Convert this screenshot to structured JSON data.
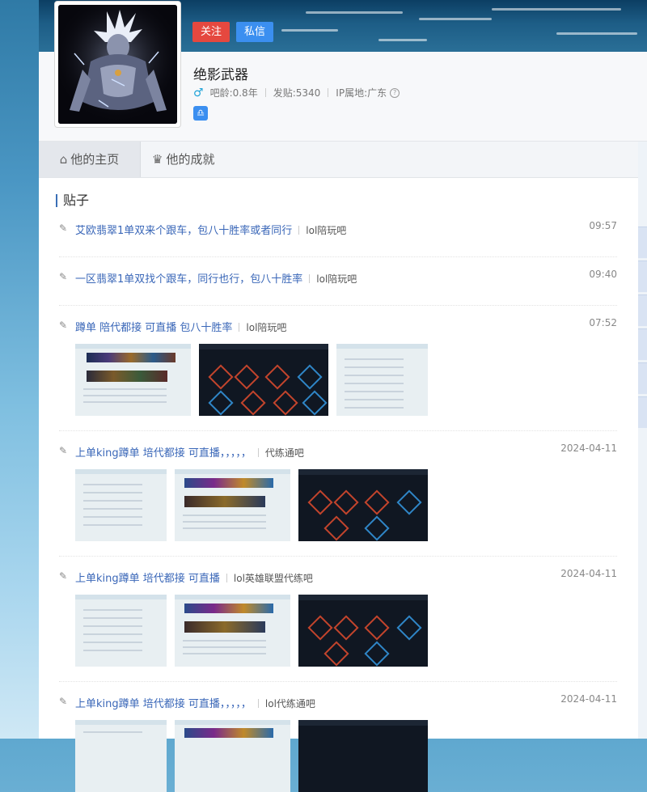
{
  "profile": {
    "username": "绝影武器",
    "follow_label": "关注",
    "message_label": "私信",
    "age": "吧龄:0.8年",
    "posts": "发贴:5340",
    "ip": "IP属地:广东"
  },
  "icons": {
    "gender": "male-icon",
    "help": "help-icon",
    "badge": "libra-badge-icon",
    "home": "home-icon",
    "achievement": "achievement-icon",
    "edit": "edit-icon"
  },
  "colors": {
    "follow": "#e5483f",
    "message": "#3b8ff0",
    "link": "#3a67b8"
  },
  "tabs": {
    "home": "他的主页",
    "achievements": "他的成就"
  },
  "section": {
    "title": "贴子"
  },
  "posts": [
    {
      "title": "艾欧翡翠1单双来个跟车，包八十胜率或者同行",
      "forum": "lol陪玩吧",
      "time": "09:57"
    },
    {
      "title": "一区翡翠1单双找个跟车，同行也行，包八十胜率",
      "forum": "lol陪玩吧",
      "time": "09:40"
    },
    {
      "title": "蹲单 陪代都接 可直播 包八十胜率",
      "forum": "lol陪玩吧",
      "time": "07:52"
    },
    {
      "title": "上单king蹲单 培代都接 可直播，，，，，",
      "forum": "代练通吧",
      "time": "2024-04-11"
    },
    {
      "title": "上单king蹲单 培代都接 可直播",
      "forum": "lol英雄联盟代练吧",
      "time": "2024-04-11"
    },
    {
      "title": "上单king蹲单 培代都接 可直播，，，，，",
      "forum": "lol代练通吧",
      "time": "2024-04-11"
    }
  ]
}
